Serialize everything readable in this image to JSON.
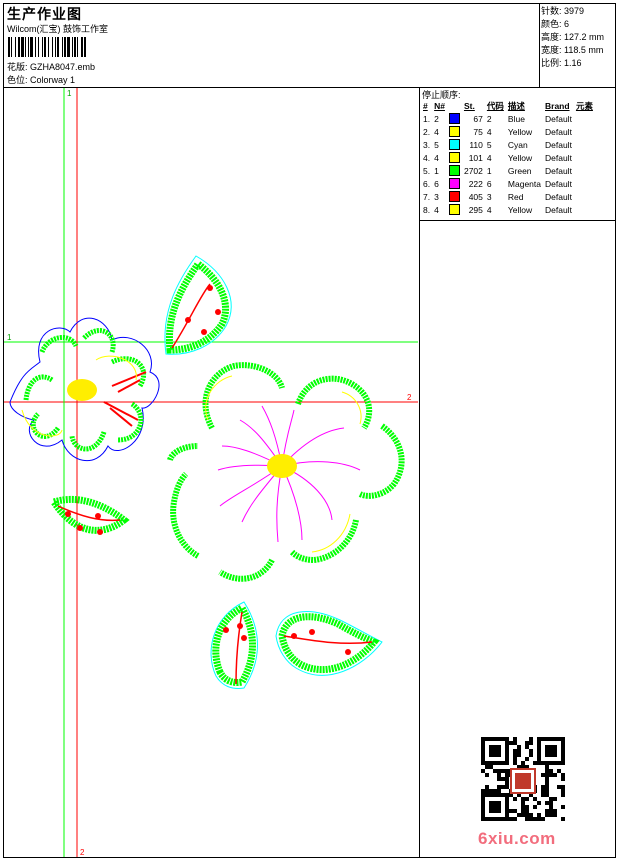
{
  "header": {
    "title": "生产作业图",
    "company": "Wilcom(汇宝) 鼓饰工作室",
    "design_label": "花版:",
    "design_file": "GZHA8047.emb",
    "colorway_label": "色位:",
    "colorway": "Colorway 1"
  },
  "stats": [
    {
      "label": "针数:",
      "value": "3979"
    },
    {
      "label": "颜色:",
      "value": "6"
    },
    {
      "label": "高度:",
      "value": "127.2 mm"
    },
    {
      "label": "宽度:",
      "value": "118.5 mm"
    },
    {
      "label": "比例:",
      "value": "1.16"
    }
  ],
  "sequence": {
    "heading": "停止顺序:",
    "columns": [
      "#",
      "N#",
      "St.",
      "代码",
      "描述",
      "Brand",
      "元素"
    ],
    "rows": [
      {
        "idx": "1.",
        "needle": "2",
        "color": "#0000ff",
        "stitches": "67",
        "code": "2",
        "desc": "Blue",
        "brand": "Default"
      },
      {
        "idx": "2.",
        "needle": "4",
        "color": "#ffff00",
        "stitches": "75",
        "code": "4",
        "desc": "Yellow",
        "brand": "Default"
      },
      {
        "idx": "3.",
        "needle": "5",
        "color": "#00ffff",
        "stitches": "110",
        "code": "5",
        "desc": "Cyan",
        "brand": "Default"
      },
      {
        "idx": "4.",
        "needle": "4",
        "color": "#ffff00",
        "stitches": "101",
        "code": "4",
        "desc": "Yellow",
        "brand": "Default"
      },
      {
        "idx": "5.",
        "needle": "1",
        "color": "#00ff00",
        "stitches": "2702",
        "code": "1",
        "desc": "Green",
        "brand": "Default"
      },
      {
        "idx": "6.",
        "needle": "6",
        "color": "#ff00ff",
        "stitches": "222",
        "code": "6",
        "desc": "Magenta",
        "brand": "Default"
      },
      {
        "idx": "7.",
        "needle": "3",
        "color": "#ff0000",
        "stitches": "405",
        "code": "3",
        "desc": "Red",
        "brand": "Default"
      },
      {
        "idx": "8.",
        "needle": "4",
        "color": "#ffff00",
        "stitches": "295",
        "code": "4",
        "desc": "Yellow",
        "brand": "Default"
      }
    ]
  },
  "guides": {
    "h1": "1",
    "h2": "2",
    "v1": "1",
    "v2": "2"
  },
  "watermark": "6xiu.com",
  "colors": {
    "green": "#00ff00",
    "blue": "#0000ff",
    "cyan": "#00ffff",
    "yellow": "#ffff00",
    "magenta": "#ff00ff",
    "red": "#ff0000"
  }
}
